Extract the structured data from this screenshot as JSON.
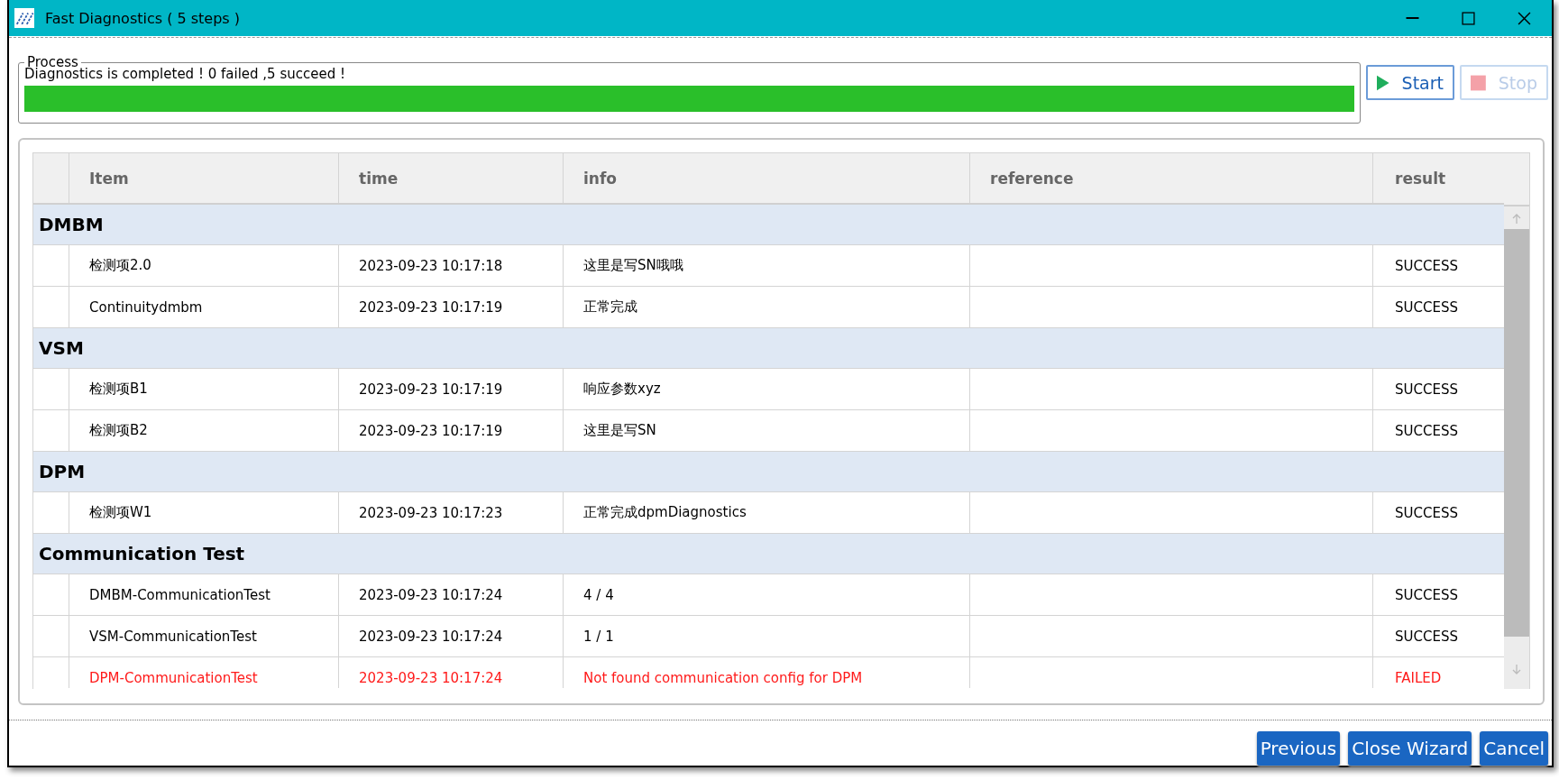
{
  "window": {
    "title": "Fast Diagnostics ( 5 steps )"
  },
  "process": {
    "label": "Process",
    "message": "Diagnostics is completed ! 0 failed ,5 succeed !",
    "level": 1
  },
  "controls": [
    {
      "kind": "start",
      "label": "Start",
      "disabled": false
    },
    {
      "kind": "stop",
      "label": "Stop",
      "disabled": true
    }
  ],
  "table": {
    "columns": [
      "Item",
      "time",
      "info",
      "reference",
      "result"
    ],
    "groups": [
      {
        "name": "DMBM",
        "rows": [
          {
            "item": "检测项2.0",
            "time": "2023-09-23 10:17:18",
            "info": "这里是写SN哦哦",
            "result": "SUCCESS",
            "failed": false
          },
          {
            "item": "Continuitydmbm",
            "time": "2023-09-23 10:17:19",
            "info": "正常完成",
            "result": "SUCCESS",
            "failed": false
          }
        ]
      },
      {
        "name": "VSM",
        "rows": [
          {
            "item": "检测项B1",
            "time": "2023-09-23 10:17:19",
            "info": "响应参数xyz",
            "result": "SUCCESS",
            "failed": false
          },
          {
            "item": "检测项B2",
            "time": "2023-09-23 10:17:19",
            "info": "这里是写SN",
            "result": "SUCCESS",
            "failed": false
          }
        ]
      },
      {
        "name": "DPM",
        "rows": [
          {
            "item": "检测项W1",
            "time": "2023-09-23 10:17:23",
            "info": "正常完成dpmDiagnostics",
            "result": "SUCCESS",
            "failed": false
          }
        ]
      },
      {
        "name": "Communication Test",
        "rows": [
          {
            "item": "DMBM-CommunicationTest",
            "time": "2023-09-23 10:17:24",
            "info": "4 / 4",
            "result": "SUCCESS",
            "failed": false
          },
          {
            "item": "VSM-CommunicationTest",
            "time": "2023-09-23 10:17:24",
            "info": "1 / 1",
            "result": "SUCCESS",
            "failed": false
          },
          {
            "item": "DPM-CommunicationTest",
            "time": "2023-09-23 10:17:24",
            "info": "Not found communication config for DPM",
            "result": "FAILED",
            "failed": true
          }
        ]
      }
    ]
  },
  "buttons": [
    "Previous",
    "Close Wizard",
    "Cancel"
  ]
}
